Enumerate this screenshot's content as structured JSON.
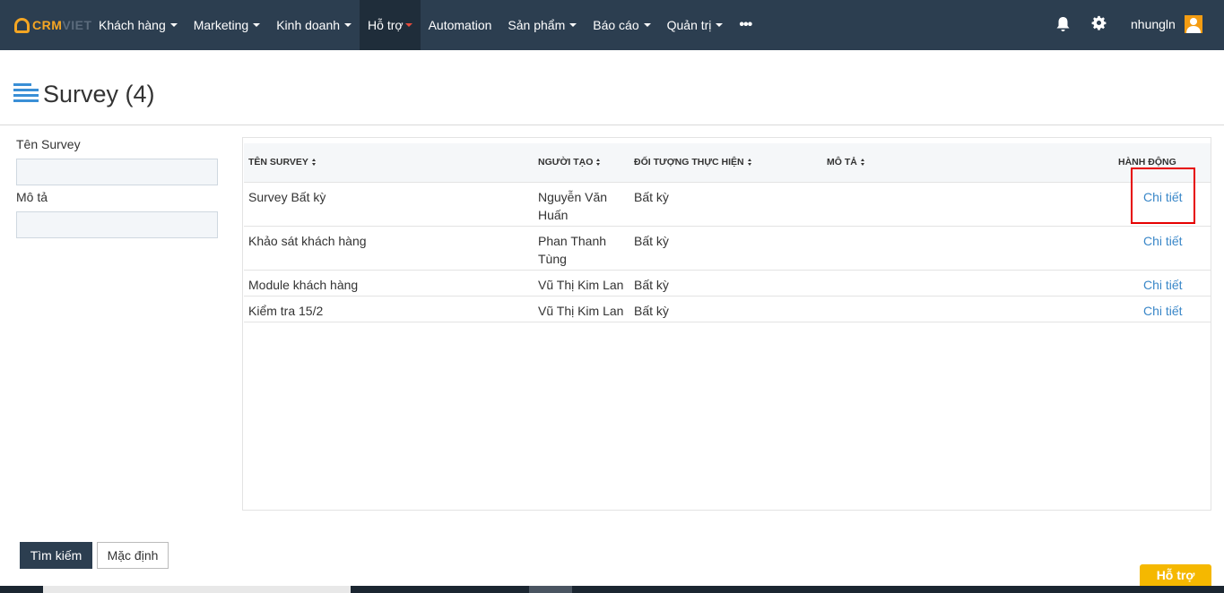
{
  "brand": {
    "logo_text_main": "CRM",
    "logo_text_dim": "VIET",
    "accent": "#f5a623"
  },
  "nav": {
    "items": [
      {
        "label": "Khách hàng",
        "dropdown": true
      },
      {
        "label": "Marketing",
        "dropdown": true
      },
      {
        "label": "Kinh doanh",
        "dropdown": true
      },
      {
        "label": "Hỗ trợ",
        "dropdown": true,
        "active": true
      },
      {
        "label": "Automation",
        "dropdown": false
      },
      {
        "label": "Sản phẩm",
        "dropdown": true
      },
      {
        "label": "Báo cáo",
        "dropdown": true
      },
      {
        "label": "Quản trị",
        "dropdown": true
      }
    ],
    "more_icon": "ellipsis-icon",
    "bell_icon": "bell-icon",
    "settings_icon": "gear-icon",
    "username": "nhungln",
    "avatar_icon": "user-avatar-icon"
  },
  "page": {
    "title": "Survey (4)",
    "title_icon": "list-icon"
  },
  "filters": {
    "name_label": "Tên Survey",
    "name_value": "",
    "desc_label": "Mô tả",
    "desc_value": ""
  },
  "table": {
    "headers": [
      "TÊN SURVEY",
      "NGƯỜI TẠO",
      "ĐỐI TƯỢNG THỰC HIỆN",
      "MÔ TẢ",
      "HÀNH ĐỘNG"
    ],
    "rows": [
      {
        "name": "Survey Bất kỳ",
        "creator": "Nguyễn Văn Huấn",
        "target": "Bất kỳ",
        "description": "",
        "action": "Chi tiết"
      },
      {
        "name": "Khảo sát khách hàng",
        "creator": "Phan Thanh Tùng",
        "target": "Bất kỳ",
        "description": "",
        "action": "Chi tiết"
      },
      {
        "name": "Module khách hàng",
        "creator": "Vũ Thị Kim Lan",
        "target": "Bất kỳ",
        "description": "",
        "action": "Chi tiết"
      },
      {
        "name": "Kiểm tra 15/2",
        "creator": "Vũ Thị Kim Lan",
        "target": "Bất kỳ",
        "description": "",
        "action": "Chi tiết"
      }
    ]
  },
  "buttons": {
    "search": "Tìm kiếm",
    "reset": "Mặc định"
  },
  "help_tab": "Hỗ trợ",
  "colors": {
    "navbar": "#2c3e50",
    "link": "#3a87c8",
    "highlight": "#e60000",
    "help": "#f5b800"
  }
}
